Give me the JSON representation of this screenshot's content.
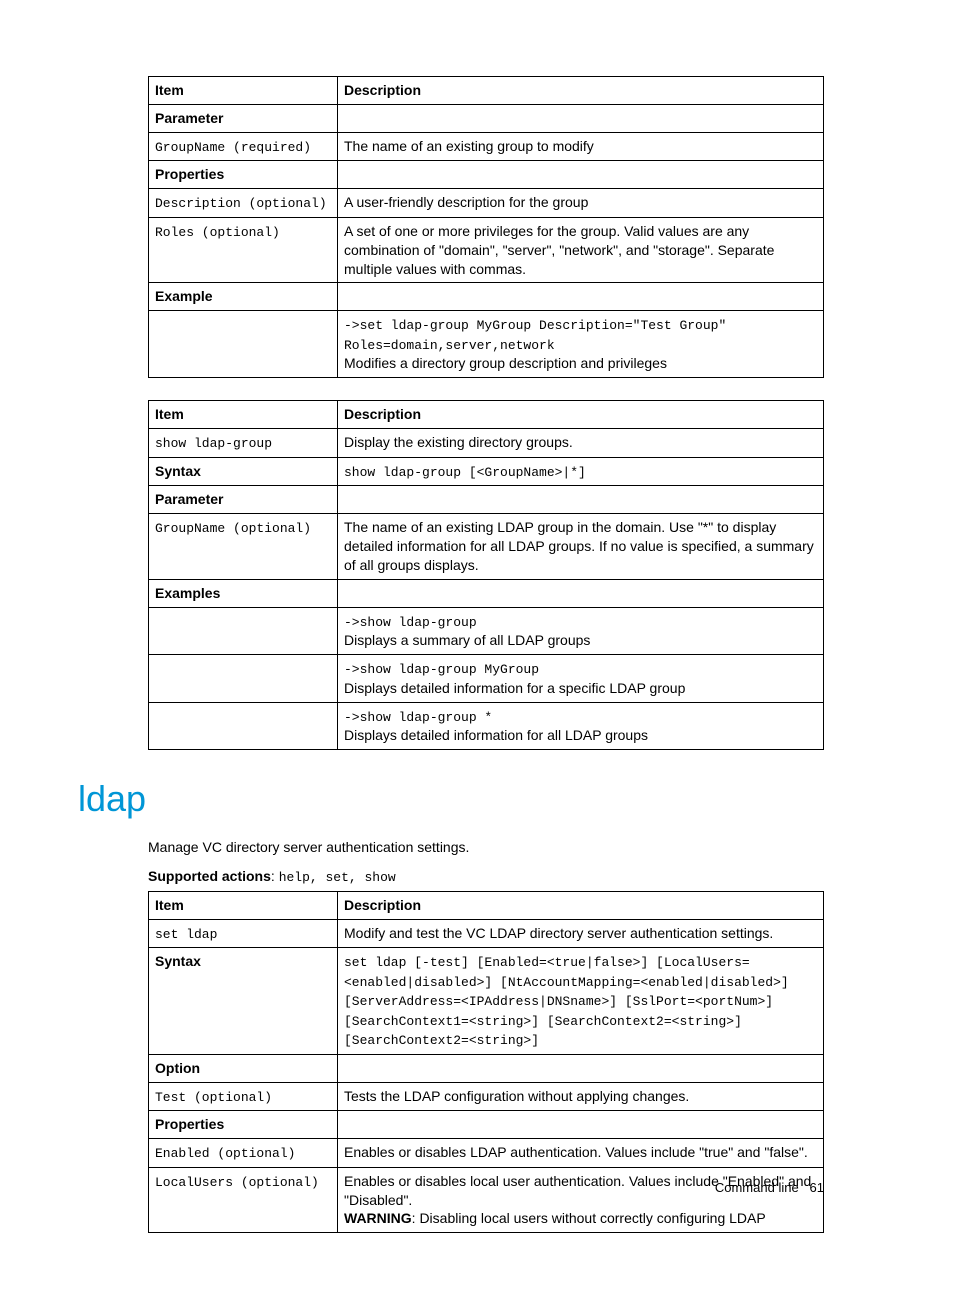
{
  "tableA": {
    "header": {
      "item": "Item",
      "desc": "Description"
    },
    "rows": [
      {
        "item_html": "<span class='th'>Parameter</span>",
        "desc_html": ""
      },
      {
        "item_html": "<span class='mono'>GroupName (required)</span>",
        "desc_html": "The name of an existing group to modify"
      },
      {
        "item_html": "<span class='th'>Properties</span>",
        "desc_html": ""
      },
      {
        "item_html": "<span class='mono'>Description (optional)</span>",
        "desc_html": "A user-friendly description for the group"
      },
      {
        "item_html": "<span class='mono'>Roles (optional)</span>",
        "desc_html": "A set of one or more privileges for the group. Valid values are any combination of \"domain\", \"server\", \"network\", and \"storage\". Separate multiple values with commas."
      },
      {
        "item_html": "<span class='th'>Example</span>",
        "desc_html": ""
      },
      {
        "item_html": "",
        "desc_html": "<span class='mono'>-&gt;set ldap-group MyGroup Description=\"Test Group\" Roles=domain,server,network</span><br>Modifies a directory group description and privileges"
      }
    ]
  },
  "tableB": {
    "header": {
      "item": "Item",
      "desc": "Description"
    },
    "rows": [
      {
        "item_html": "<span class='mono'>show ldap-group</span>",
        "desc_html": "Display the existing directory groups."
      },
      {
        "item_html": "<span class='th'>Syntax</span>",
        "desc_html": "<span class='mono'>show ldap-group [&lt;GroupName&gt;|*]</span>"
      },
      {
        "item_html": "<span class='th'>Parameter</span>",
        "desc_html": ""
      },
      {
        "item_html": "<span class='mono'>GroupName (optional)</span>",
        "desc_html": "The name of an existing LDAP group in the domain. Use \"*\" to display detailed information for all LDAP groups. If no value is specified, a summary of all groups displays."
      },
      {
        "item_html": "<span class='th'>Examples</span>",
        "desc_html": ""
      },
      {
        "item_html": "",
        "desc_html": "<span class='mono'>-&gt;show ldap-group</span><br>Displays a summary of all LDAP groups"
      },
      {
        "item_html": "",
        "desc_html": "<span class='mono'>-&gt;show ldap-group MyGroup</span><br>Displays detailed information for a specific LDAP group"
      },
      {
        "item_html": "",
        "desc_html": "<span class='mono'>-&gt;show ldap-group *</span><br>Displays detailed information for all LDAP groups"
      }
    ]
  },
  "section_heading": "ldap",
  "intro": "Manage VC directory server authentication settings.",
  "supported_label": "Supported actions",
  "supported_actions": "help, set, show",
  "tableC": {
    "header": {
      "item": "Item",
      "desc": "Description"
    },
    "rows": [
      {
        "item_html": "<span class='mono'>set ldap</span>",
        "desc_html": "Modify and test the VC LDAP directory server authentication settings."
      },
      {
        "item_html": "<span class='th'>Syntax</span>",
        "desc_html": "<span class='mono'>set ldap [-test] [Enabled=&lt;true|false&gt;] [LocalUsers=&lt;enabled|disabled&gt;] [NtAccountMapping=&lt;enabled|disabled&gt;] [ServerAddress=&lt;IPAddress|DNSname&gt;] [SslPort=&lt;portNum&gt;] [SearchContext1=&lt;string&gt;] [SearchContext2=&lt;string&gt;] [SearchContext2=&lt;string&gt;]</span>"
      },
      {
        "item_html": "<span class='th'>Option</span>",
        "desc_html": ""
      },
      {
        "item_html": "<span class='mono'>Test (optional)</span>",
        "desc_html": "Tests the LDAP configuration without applying changes."
      },
      {
        "item_html": "<span class='th'>Properties</span>",
        "desc_html": ""
      },
      {
        "item_html": "<span class='mono'>Enabled (optional)</span>",
        "desc_html": "Enables or disables LDAP authentication. Values include \"true\" and \"false\"."
      },
      {
        "item_html": "<span class='mono'>LocalUsers (optional)</span>",
        "desc_html": "Enables or disables local user authentication. Values include \"Enabled\" and \"Disabled\".<br><span class='warn'>WARNING</span>: Disabling local users without correctly configuring LDAP"
      }
    ]
  },
  "footer": {
    "label": "Command line",
    "page": "61"
  }
}
